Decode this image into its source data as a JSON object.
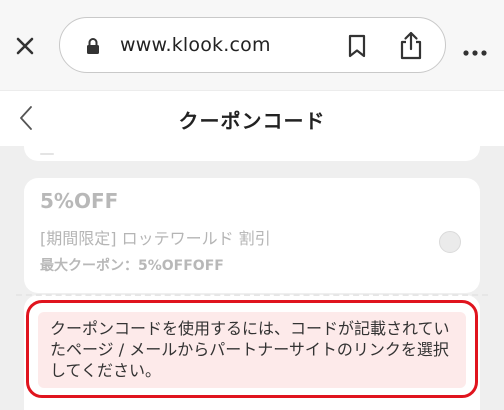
{
  "browser": {
    "url": "www.klook.com",
    "icons": {
      "close": "close-icon",
      "lock": "lock-icon",
      "bookmark": "bookmark-icon",
      "share": "share-icon",
      "more": "more-horizontal-icon"
    }
  },
  "header": {
    "title": "クーポンコード",
    "back_icon": "chevron-left-icon"
  },
  "coupon": {
    "title": "5%OFF",
    "description": "[期間限定] ロッテワールド 割引",
    "max_label": "最大クーポン：5%OFFOFF",
    "selected": false
  },
  "notice": {
    "text": "クーポンコードを使用するには、コードが記載されていたページ / メールからパートナーサイトのリンクを選択してください。"
  },
  "colors": {
    "highlight_border": "#e0141e",
    "notice_background": "#fdeaea"
  }
}
